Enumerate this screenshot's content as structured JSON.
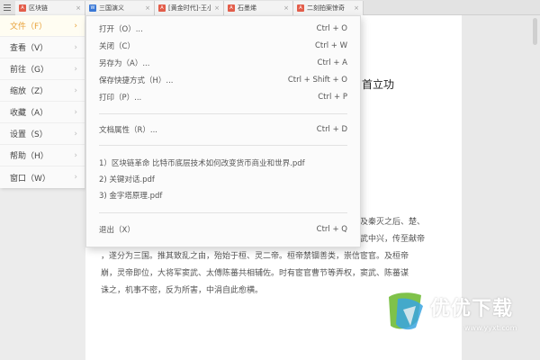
{
  "tabs": [
    {
      "label": "区块链",
      "icon": "pdf-icon",
      "color": "#e35d4a"
    },
    {
      "label": "三国演义",
      "icon": "word-icon",
      "color": "#3a78d6"
    },
    {
      "label": "[黄金时代]-王小波",
      "icon": "pdf-icon",
      "color": "#e35d4a"
    },
    {
      "label": "石墨烯",
      "icon": "pdf-icon",
      "color": "#e35d4a"
    },
    {
      "label": "二刻拍案惊奇",
      "icon": "pdf-icon",
      "color": "#e35d4a"
    }
  ],
  "left_menu": [
    {
      "label": "文件（F）"
    },
    {
      "label": "查看（V）"
    },
    {
      "label": "前往（G）"
    },
    {
      "label": "缩放（Z）"
    },
    {
      "label": "收藏（A）"
    },
    {
      "label": "设置（S）"
    },
    {
      "label": "帮助（H）"
    },
    {
      "label": "窗口（W）"
    }
  ],
  "file_menu": {
    "open": {
      "label": "打开（O）...",
      "shortcut": "Ctrl + O"
    },
    "close": {
      "label": "关闭（C）",
      "shortcut": "Ctrl + W"
    },
    "save_as": {
      "label": "另存为（A）...",
      "shortcut": "Ctrl + A"
    },
    "save_shortcut": {
      "label": "保存快捷方式（H）...",
      "shortcut": "Ctrl + Shift + O"
    },
    "print": {
      "label": "打印（P）...",
      "shortcut": "Ctrl + P"
    },
    "properties": {
      "label": "文档属性（R）...",
      "shortcut": "Ctrl + D"
    },
    "recent": [
      "1）区块链革命 比特币底层技术如何改变货币商业和世界.pdf",
      "2) 关键对话.pdf",
      "3) 金字塔原理.pdf"
    ],
    "exit": {
      "label": "退出（X）",
      "shortcut": "Ctrl + Q"
    }
  },
  "document": {
    "heading_fragment": "首立功",
    "lines": [
      "及秦灭之后、楚、",
      "武中兴，传至献帝",
      "，遂分为三国。推其致乱之由，殆始于桓、灵二帝。桓帝禁锢善类，崇信宦官。及桓帝",
      "崩，灵帝即位，大将军窦武、太傅陈蕃共相辅佐。时有宦官曹节等弄权，窦武、陈蕃谋",
      "诛之，机事不密，反为所害，中涓自此愈横。"
    ]
  },
  "watermark": {
    "brand": "优优下载",
    "url": "www.yyxt.com"
  },
  "colors": {
    "accent": "#e8a23a",
    "pdf": "#e35d4a",
    "word": "#3a78d6"
  }
}
